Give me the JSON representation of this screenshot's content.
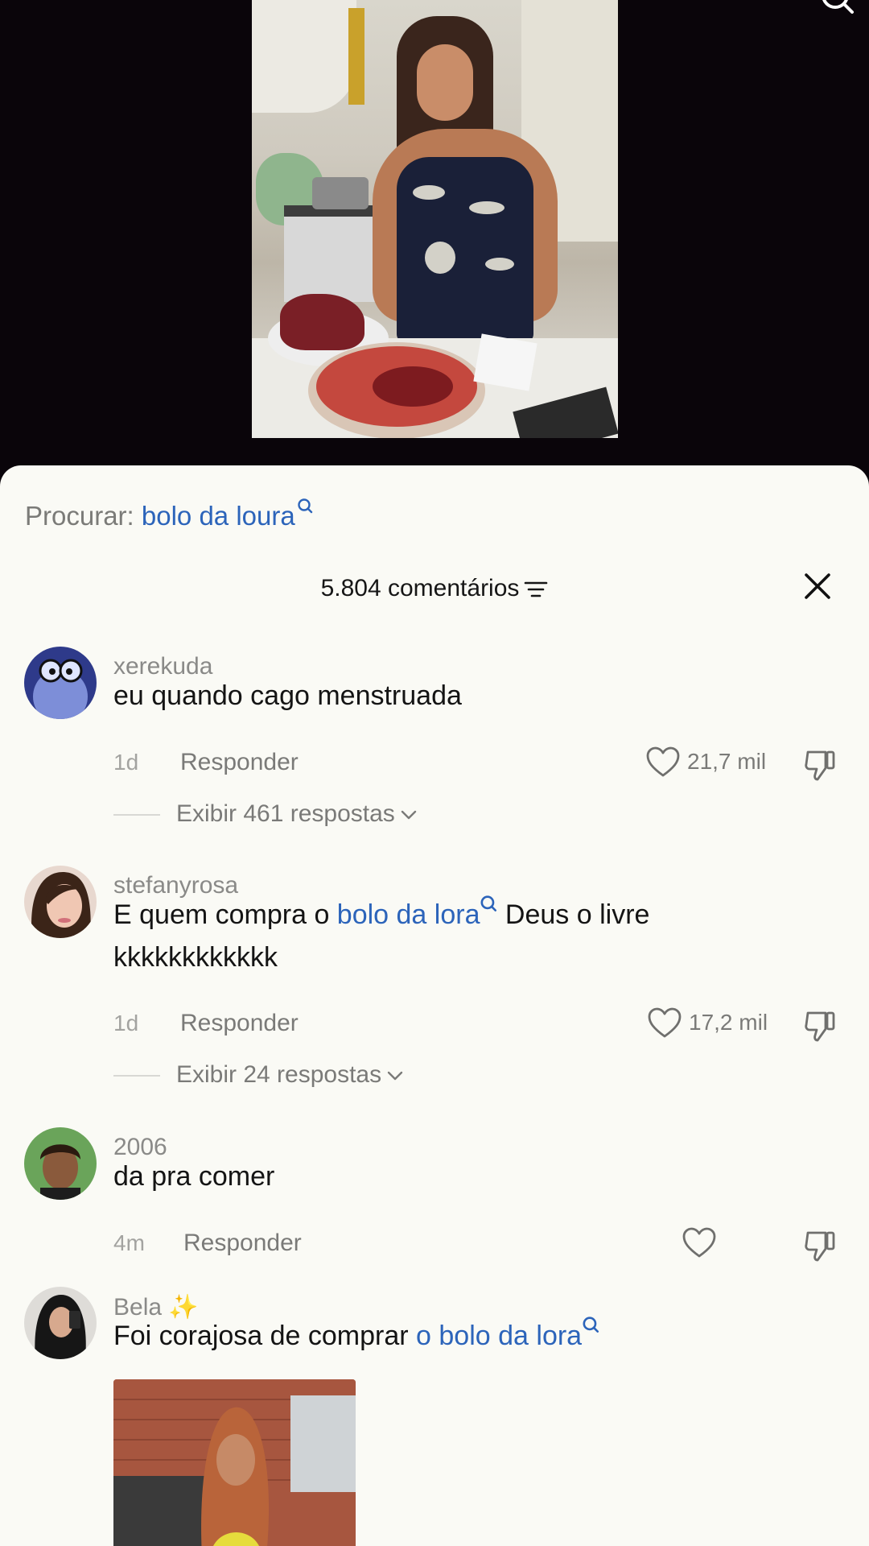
{
  "search": {
    "label": "Procurar:",
    "term": "bolo da loura"
  },
  "header": {
    "count_label": "5.804 comentários"
  },
  "comments": [
    {
      "username": "xerekuda",
      "text": "eu quando cago menstruada",
      "time": "1d",
      "reply_label": "Responder",
      "likes": "21,7 mil",
      "view_replies": "Exibir 461 respostas"
    },
    {
      "username": "stefanyrosa",
      "text_before": "E quem compra o ",
      "text_link": "bolo da lora",
      "text_after": " Deus o livre kkkkkkkkkkkk",
      "time": "1d",
      "reply_label": "Responder",
      "likes": "17,2 mil",
      "view_replies": "Exibir 24 respostas"
    },
    {
      "username": "2006",
      "text": "da pra comer",
      "time": "4m",
      "reply_label": "Responder",
      "likes": ""
    },
    {
      "username": "Bela",
      "username_emoji": "✨",
      "text_before": "Foi corajosa de comprar ",
      "text_link": "o bolo da lora",
      "text_after": ""
    }
  ],
  "colors": {
    "link": "#2c64ba",
    "sheet_bg": "#fafaf5",
    "video_bg": "#0a050a"
  }
}
